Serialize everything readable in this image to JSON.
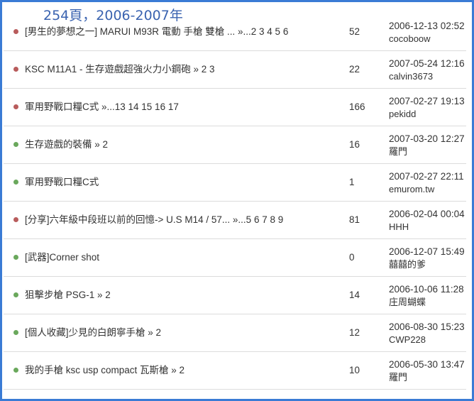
{
  "page_label": "254頁，2006-2007年",
  "colors": {
    "border": "#3a7bd5",
    "hot_dot": "#b85c5c",
    "normal_dot": "#6aa85c"
  },
  "topics": [
    {
      "title": "[男生的夢想之一] MARUI M93R 電動 手槍 雙槍 ... »...2 3 4 5 6",
      "replies": "52",
      "date": "2006-12-13 02:52",
      "author": "cocoboow",
      "dot": "hot"
    },
    {
      "title": "KSC M11A1 - 生存遊戲超強火力小鋼砲 » 2 3",
      "replies": "22",
      "date": "2007-05-24 12:16",
      "author": "calvin3673",
      "dot": "hot"
    },
    {
      "title": "軍用野戰口糧C式 »...13 14 15 16 17",
      "replies": "166",
      "date": "2007-02-27 19:13",
      "author": "pekidd",
      "dot": "hot"
    },
    {
      "title": "生存遊戲的裝備 » 2",
      "replies": "16",
      "date": "2007-03-20 12:27",
      "author": "羅門",
      "dot": "normal"
    },
    {
      "title": "軍用野戰口糧C式",
      "replies": "1",
      "date": "2007-02-27 22:11",
      "author": "emurom.tw",
      "dot": "normal"
    },
    {
      "title": "[分享]六年級中段班以前的回憶-> U.S M14 / 57... »...5 6 7 8 9",
      "replies": "81",
      "date": "2006-02-04 00:04",
      "author": "HHH",
      "dot": "hot"
    },
    {
      "title": "[武器]Corner shot",
      "replies": "0",
      "date": "2006-12-07 15:49",
      "author": "囍囍的爹",
      "dot": "normal"
    },
    {
      "title": "狙擊步槍 PSG-1 » 2",
      "replies": "14",
      "date": "2006-10-06 11:28",
      "author": "庄周蝴蝶",
      "dot": "normal"
    },
    {
      "title": "[個人收藏]少見的白朗寧手槍 » 2",
      "replies": "12",
      "date": "2006-08-30 15:23",
      "author": "CWP228",
      "dot": "normal"
    },
    {
      "title": "我的手槍 ksc usp compact 瓦斯槍 » 2",
      "replies": "10",
      "date": "2006-05-30 13:47",
      "author": "羅門",
      "dot": "normal"
    }
  ]
}
